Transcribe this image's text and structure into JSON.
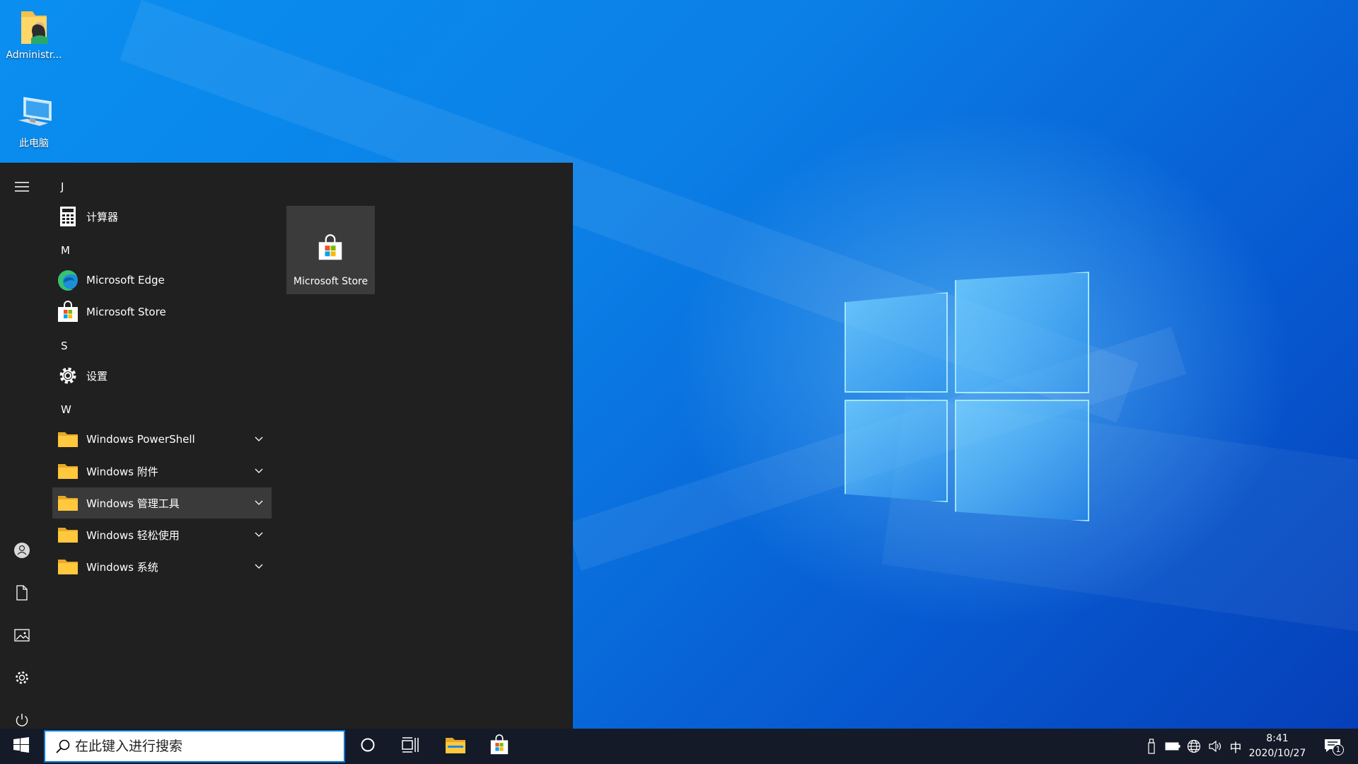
{
  "desktop": {
    "icons": [
      {
        "label": "Administr...",
        "icon": "user-folder-icon"
      },
      {
        "label": "此电脑",
        "icon": "computer-icon"
      }
    ]
  },
  "start_menu": {
    "rail": {
      "expand": "hamburger-icon",
      "account": "user-icon",
      "documents": "document-icon",
      "pictures": "pictures-icon",
      "settings": "gear-icon",
      "power": "power-icon"
    },
    "groups": [
      {
        "letter": "J",
        "items": [
          {
            "label": "计算器",
            "icon": "calculator-icon"
          }
        ]
      },
      {
        "letter": "M",
        "items": [
          {
            "label": "Microsoft Edge",
            "icon": "edge-icon"
          },
          {
            "label": "Microsoft Store",
            "icon": "store-icon"
          }
        ]
      },
      {
        "letter": "S",
        "items": [
          {
            "label": "设置",
            "icon": "gear-icon"
          }
        ]
      },
      {
        "letter": "W",
        "items": [
          {
            "label": "Windows PowerShell",
            "icon": "folder-icon",
            "expandable": true
          },
          {
            "label": "Windows 附件",
            "icon": "folder-icon",
            "expandable": true
          },
          {
            "label": "Windows 管理工具",
            "icon": "folder-icon",
            "expandable": true,
            "selected": true
          },
          {
            "label": "Windows 轻松使用",
            "icon": "folder-icon",
            "expandable": true
          },
          {
            "label": "Windows 系统",
            "icon": "folder-icon",
            "expandable": true
          }
        ]
      }
    ],
    "tiles": [
      {
        "label": "Microsoft Store",
        "icon": "store-icon"
      }
    ]
  },
  "taskbar": {
    "search_placeholder": "在此键入进行搜索",
    "ime_label": "中",
    "time": "8:41",
    "date": "2020/10/27",
    "notification_count": "1"
  },
  "colors": {
    "accent": "#0078d7",
    "start_bg": "#202020",
    "taskbar_bg": "#141a28",
    "folder_yellow": "#ffc83d"
  }
}
